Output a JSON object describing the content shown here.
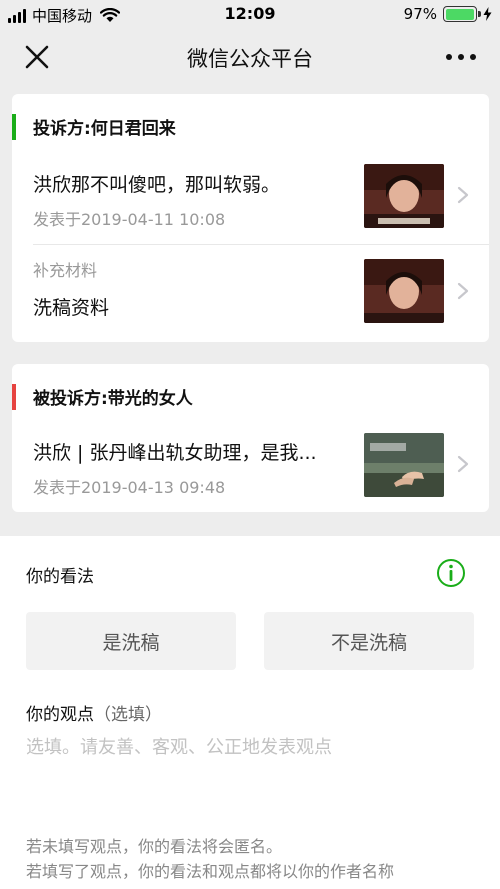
{
  "status_bar": {
    "carrier": "中国移动",
    "time": "12:09",
    "battery": "97%",
    "battery_level": 0.97,
    "battery_color": "#4cd964"
  },
  "nav": {
    "title": "微信公众平台",
    "close_icon": "close-icon",
    "more_icon": "more-icon"
  },
  "complainant": {
    "label": "投诉方:何日君回来",
    "accent": "#1aad19",
    "article": {
      "title": "洪欣那不叫傻吧，那叫软弱。",
      "date": "发表于2019-04-11 10:08"
    },
    "supplement": {
      "label": "补充材料",
      "title": "洗稿资料"
    }
  },
  "respondent": {
    "label": "被投诉方:带光的女人",
    "accent": "#e64340",
    "article": {
      "title": "洪欣 | 张丹峰出轨女助理，是我...",
      "date": "发表于2019-04-13 09:48"
    }
  },
  "opinion": {
    "label": "你的看法",
    "info_icon": "info-icon",
    "info_color": "#1aad19",
    "yes_label": "是洗稿",
    "no_label": "不是洗稿"
  },
  "viewpoint": {
    "label": "你的观点",
    "optional": "（选填）",
    "value": "",
    "placeholder": "选填。请友善、客观、公正地发表观点"
  },
  "notes": {
    "line1": "若未填写观点，你的看法将会匿名。",
    "line2": "若填写了观点，你的看法和观点都将以你的作者名称"
  }
}
